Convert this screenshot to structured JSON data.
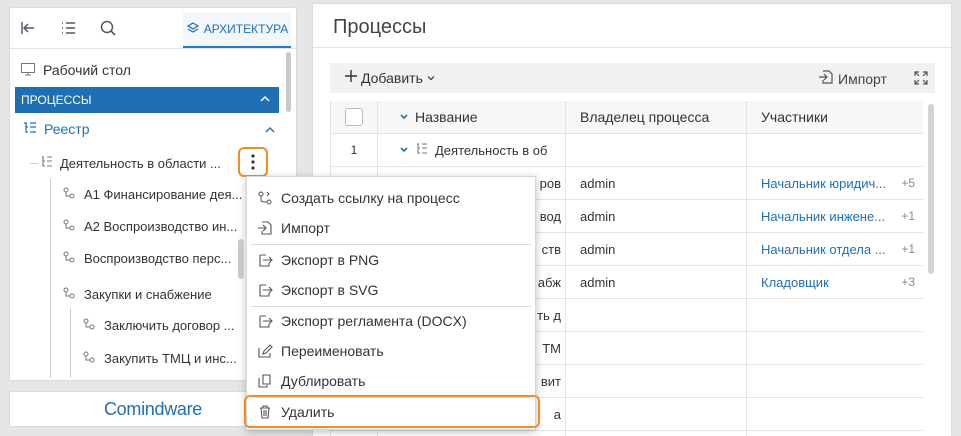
{
  "left_panel": {
    "toolbar": {
      "collapse_icon": "collapse-left-icon",
      "list_icon": "list-icon",
      "search_icon": "search-icon",
      "architecture_tab": "АРХИТЕКТУРА"
    },
    "desktop": "Рабочий стол",
    "processes_header": "ПРОЦЕССЫ",
    "registry": "Реестр",
    "tree_items": [
      "Деятельность в области ...",
      "А1 Финансирование дея...",
      "А2 Воспроизводство ин...",
      "Воспроизводство перс...",
      "Закупки и снабжение",
      "Заключить договор ...",
      "Закупить ТМЦ и инс..."
    ]
  },
  "brand": {
    "text": "Comindware"
  },
  "main": {
    "title": "Процессы",
    "toolbar": {
      "add": "Добавить",
      "import": "Импорт"
    },
    "grid": {
      "columns": [
        "Название",
        "Владелец процесса",
        "Участники"
      ],
      "rows": [
        {
          "num": "1",
          "name": "Деятельность в об",
          "owner": "",
          "participants": "",
          "more": ""
        },
        {
          "num": "",
          "name": "ров",
          "owner": "admin",
          "participants": "Начальник юридич...",
          "more": "+5"
        },
        {
          "num": "",
          "name": "вод",
          "owner": "admin",
          "participants": "Начальник инжене...",
          "more": "+1"
        },
        {
          "num": "",
          "name": "ств",
          "owner": "admin",
          "participants": "Начальник отдела ...",
          "more": "+1"
        },
        {
          "num": "",
          "name": "абж",
          "owner": "admin",
          "participants": "Кладовщик",
          "more": "+3"
        },
        {
          "num": "",
          "name": "ть д",
          "owner": "",
          "participants": "",
          "more": ""
        },
        {
          "num": "",
          "name": "ТМ",
          "owner": "",
          "participants": "",
          "more": ""
        },
        {
          "num": "",
          "name": "вит",
          "owner": "",
          "participants": "",
          "more": ""
        },
        {
          "num": "",
          "name": "а",
          "owner": "",
          "participants": "",
          "more": ""
        }
      ]
    }
  },
  "context_menu": {
    "items": [
      {
        "label": "Создать ссылку на процесс",
        "icon": "link-process-icon"
      },
      {
        "label": "Импорт",
        "icon": "import-icon"
      },
      {
        "label": "Экспорт в PNG",
        "icon": "export-icon"
      },
      {
        "label": "Экспорт в SVG",
        "icon": "export-icon"
      },
      {
        "label": "Экспорт регламента (DOCX)",
        "icon": "export-icon"
      },
      {
        "label": "Переименовать",
        "icon": "rename-icon"
      },
      {
        "label": "Дублировать",
        "icon": "duplicate-icon"
      },
      {
        "label": "Удалить",
        "icon": "trash-icon"
      }
    ]
  },
  "colors": {
    "accent": "#1f6fb5",
    "highlight": "#f08c2a"
  }
}
